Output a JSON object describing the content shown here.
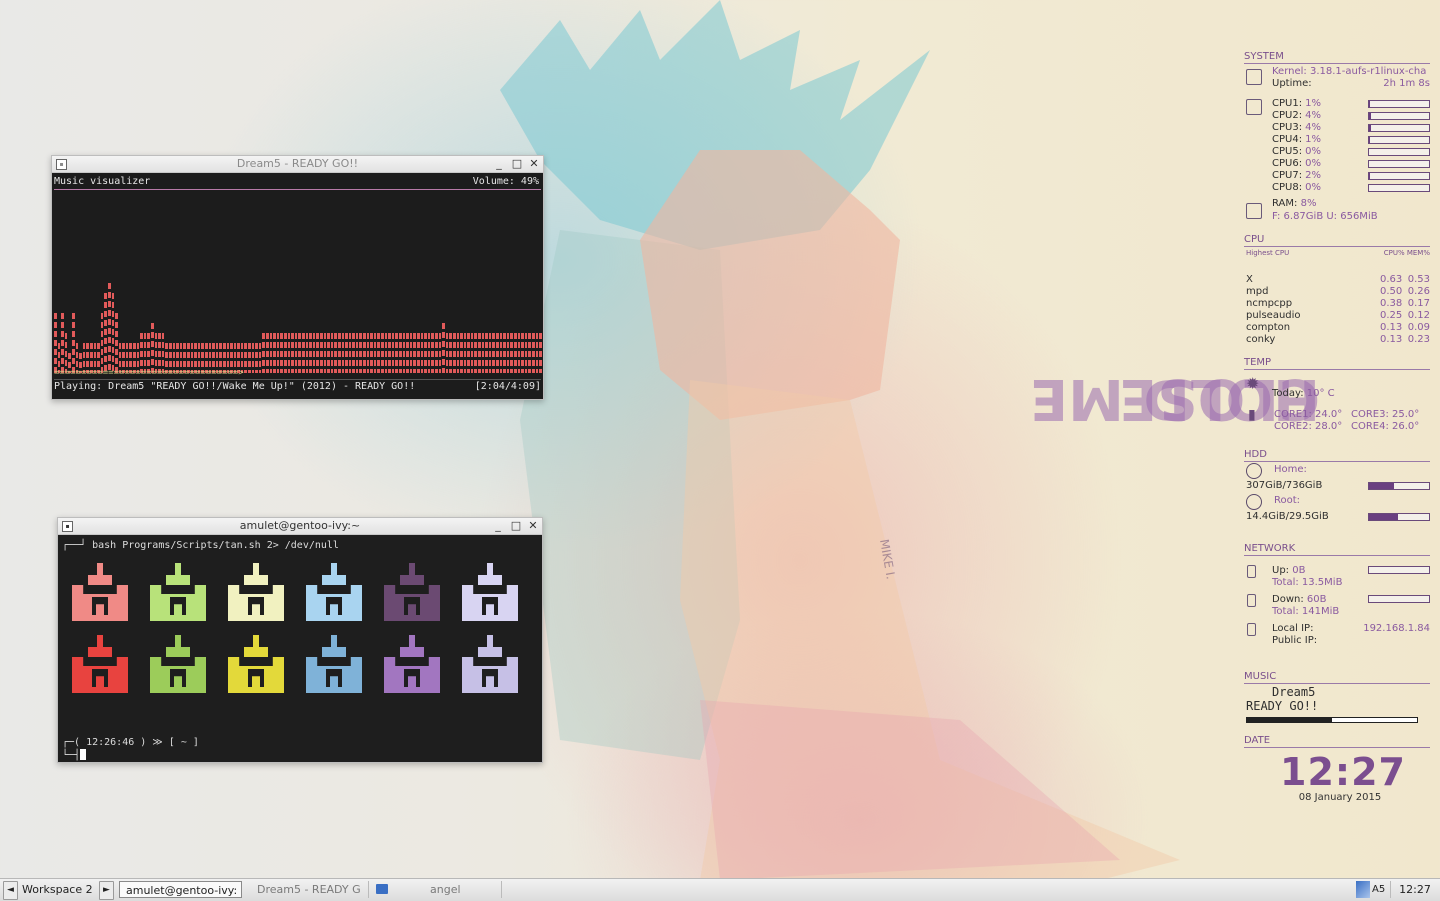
{
  "wallpaper": {
    "text_lines": [
      "HOLD ME",
      "CLOSE"
    ],
    "signature": "MIKE I."
  },
  "visualizer_window": {
    "title": "Dream5 - READY GO!!",
    "header_left": "Music visualizer",
    "header_right": "Volume: 49%",
    "progress_text": "==================================>",
    "playing": "Playing: Dream5 \"READY GO!!/Wake Me Up!\" (2012) - READY GO!!",
    "time": "[2:04/4:09]",
    "bar_color": "#e15a5a",
    "levels": [
      6,
      3,
      6,
      4,
      2,
      6,
      3,
      2,
      3,
      3,
      3,
      3,
      3,
      6,
      8,
      9,
      8,
      6,
      3,
      3,
      3,
      3,
      3,
      3,
      4,
      4,
      4,
      5,
      4,
      4,
      4,
      3,
      3,
      3,
      3,
      3,
      3,
      3,
      3,
      3,
      3,
      3,
      3,
      3,
      3,
      3,
      3,
      3,
      3,
      3,
      3,
      3,
      3,
      3,
      3,
      3,
      3,
      3,
      4,
      4,
      4,
      4,
      4,
      4,
      4,
      4,
      4,
      4,
      4,
      4,
      4,
      4,
      4,
      4,
      4,
      4,
      4,
      4,
      4,
      4,
      4,
      4,
      4,
      4,
      4,
      4,
      4,
      4,
      4,
      4,
      4,
      4,
      4,
      4,
      4,
      4,
      4,
      4,
      4,
      4,
      4,
      4,
      4,
      4,
      4,
      4,
      4,
      4,
      5,
      4,
      4,
      4,
      4,
      4,
      4,
      4,
      4,
      4,
      4,
      4,
      4,
      4,
      4,
      4,
      4,
      4,
      4,
      4,
      4,
      4,
      4,
      4,
      4,
      4,
      4,
      4
    ]
  },
  "terminal_window": {
    "title": "amulet@gentoo-ivy:~",
    "command": "┌──┘ bash Programs/Scripts/tan.sh 2> /dev/null",
    "prompt_line1": "┌─( 12:26:46 ) ≫ [ ~ ]",
    "prompt_line2": "└─┤",
    "tank_colors": [
      "#f08a86",
      "#b8e27a",
      "#f1f1c0",
      "#a9d4f0",
      "#6b4a72",
      "#d8d4f2",
      "#e8433f",
      "#9ccc5a",
      "#e3d93a",
      "#7fb2d8",
      "#a276c0",
      "#c6c0e6"
    ]
  },
  "conky": {
    "system": {
      "title": "SYSTEM",
      "kernel_label": "Kernel:",
      "kernel_value": "3.18.1-aufs-r1linux-cha",
      "uptime_label": "Uptime:",
      "uptime_value": "2h 1m 8s",
      "cpus": [
        {
          "label": "CPU1:",
          "value": "1%",
          "level": 0.01
        },
        {
          "label": "CPU2:",
          "value": "4%",
          "level": 0.04
        },
        {
          "label": "CPU3:",
          "value": "4%",
          "level": 0.04
        },
        {
          "label": "CPU4:",
          "value": "1%",
          "level": 0.01
        },
        {
          "label": "CPU5:",
          "value": "0%",
          "level": 0.0
        },
        {
          "label": "CPU6:",
          "value": "0%",
          "level": 0.0
        },
        {
          "label": "CPU7:",
          "value": "2%",
          "level": 0.02
        },
        {
          "label": "CPU8:",
          "value": "0%",
          "level": 0.0
        }
      ],
      "ram_label": "RAM:",
      "ram_value": "8%",
      "mem_line": "F: 6.87GiB U: 656MiB"
    },
    "cpu": {
      "title": "CPU",
      "sub_left": "Highest CPU",
      "sub_right": "CPU% MEM%",
      "procs": [
        {
          "name": "X",
          "cpu": "0.63",
          "mem": "0.53"
        },
        {
          "name": "mpd",
          "cpu": "0.50",
          "mem": "0.26"
        },
        {
          "name": "ncmpcpp",
          "cpu": "0.38",
          "mem": "0.17"
        },
        {
          "name": "pulseaudio",
          "cpu": "0.25",
          "mem": "0.12"
        },
        {
          "name": "compton",
          "cpu": "0.13",
          "mem": "0.09"
        },
        {
          "name": "conky",
          "cpu": "0.13",
          "mem": "0.23"
        }
      ]
    },
    "temp": {
      "title": "TEMP",
      "today_label": "Today:",
      "today_value": "10° C",
      "core1": "CORE1: 24.0°",
      "core2": "CORE2: 28.0°",
      "core3": "CORE3: 25.0°",
      "core4": "CORE4: 26.0°"
    },
    "hdd": {
      "title": "HDD",
      "home_label": "Home:",
      "home_value": "307GiB/736GiB",
      "home_level": 0.42,
      "root_label": "Root:",
      "root_value": "14.4GiB/29.5GiB",
      "root_level": 0.49
    },
    "network": {
      "title": "NETWORK",
      "up_label": "Up:",
      "up_value": "0B",
      "up_total": "Total: 13.5MiB",
      "down_label": "Down:",
      "down_value": "60B",
      "down_total": "Total: 141MiB",
      "local_ip_label": "Local IP:",
      "local_ip_value": "192.168.1.84",
      "public_ip_label": "Public IP:"
    },
    "music": {
      "title": "MUSIC",
      "artist": "Dream5",
      "song": "READY GO!!",
      "progress": 0.5
    },
    "date": {
      "title": "DATE",
      "time": "12:27",
      "date": "08 January 2015"
    }
  },
  "taskbar": {
    "prev_icon": "◄",
    "workspace": "Workspace 2",
    "next_icon": "►",
    "task1": "amulet@gentoo-ivy:",
    "task2": "Dream5 - READY G",
    "task3": "angel",
    "tray_label": "A5",
    "clock": "12:27"
  }
}
